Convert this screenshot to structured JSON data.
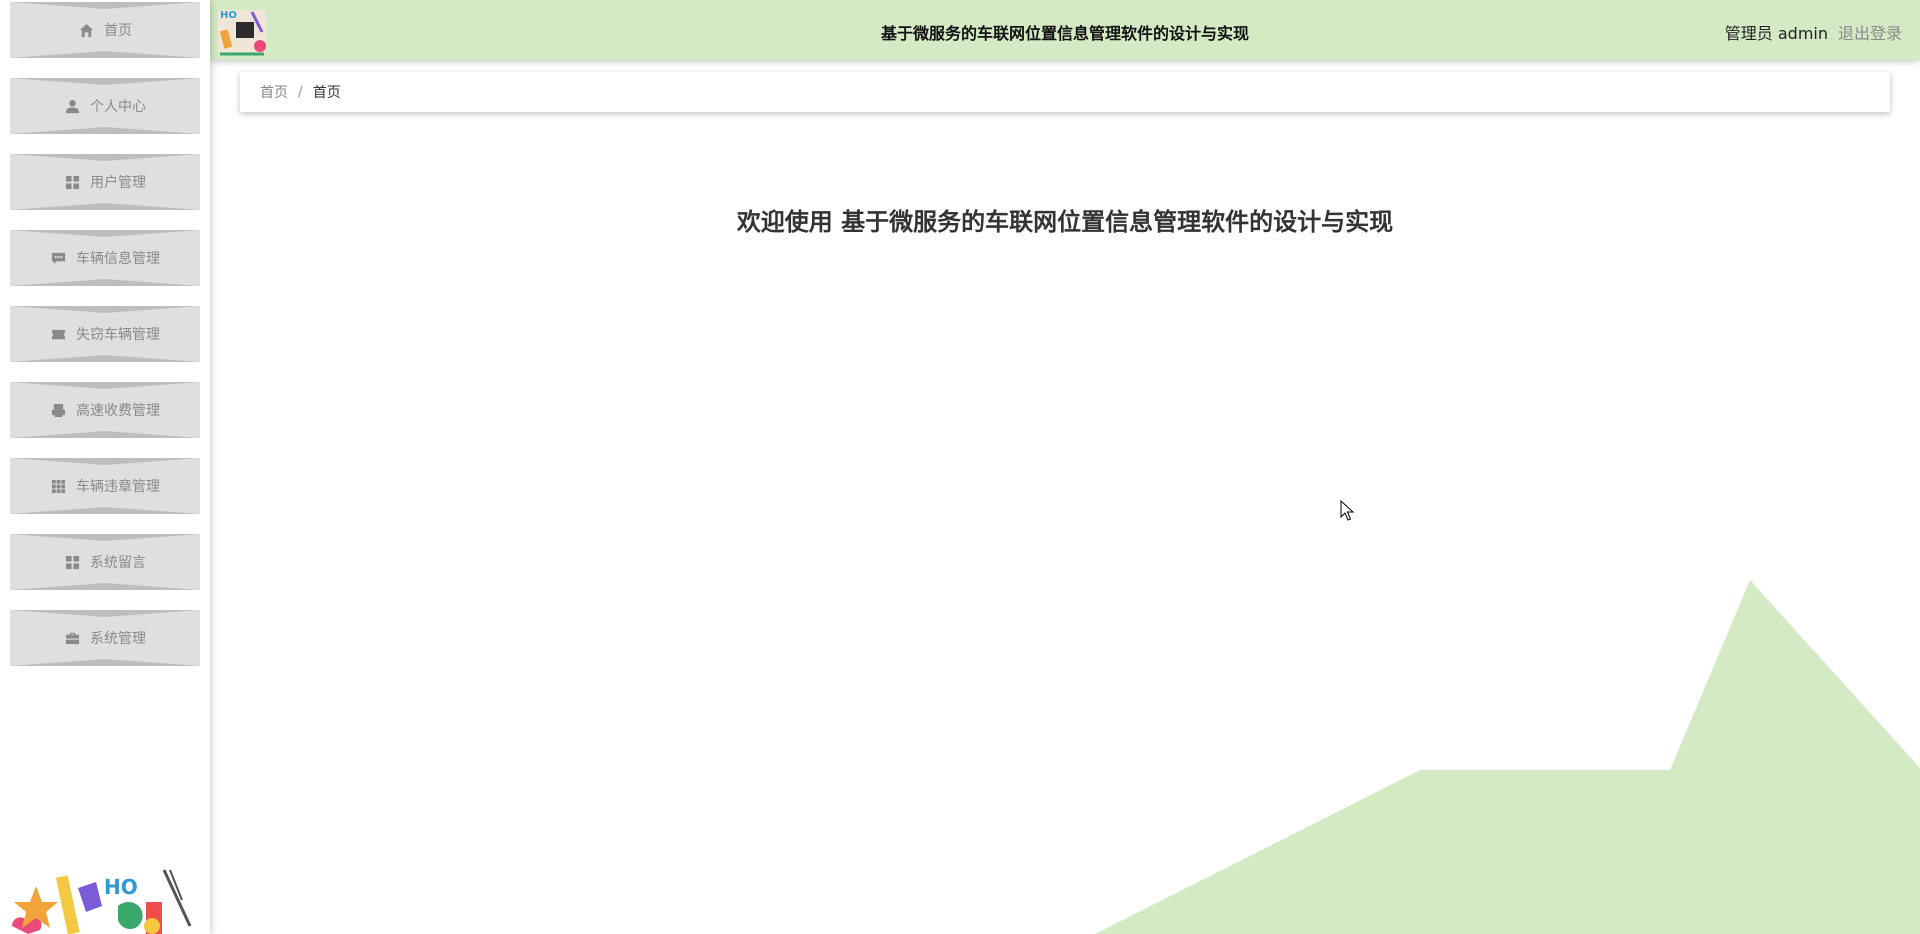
{
  "sidebar": {
    "items": [
      {
        "label": "首页",
        "icon": "home-icon"
      },
      {
        "label": "个人中心",
        "icon": "user-icon"
      },
      {
        "label": "用户管理",
        "icon": "grid-icon"
      },
      {
        "label": "车辆信息管理",
        "icon": "comment-icon"
      },
      {
        "label": "失窃车辆管理",
        "icon": "ticket-icon"
      },
      {
        "label": "高速收费管理",
        "icon": "printer-icon"
      },
      {
        "label": "车辆违章管理",
        "icon": "apps-icon"
      },
      {
        "label": "系统留言",
        "icon": "grid-icon"
      },
      {
        "label": "系统管理",
        "icon": "briefcase-icon"
      }
    ]
  },
  "header": {
    "title": "基于微服务的车联网位置信息管理软件的设计与实现",
    "user": "管理员 admin",
    "logout": "退出登录"
  },
  "breadcrumb": {
    "home": "首页",
    "separator": "/",
    "current": "首页"
  },
  "main": {
    "welcome": "欢迎使用 基于微服务的车联网位置信息管理软件的设计与实现"
  },
  "colors": {
    "header_bg": "#d4eac4",
    "menu_bg": "#dfdfdf",
    "shape_green": "#d4eac4"
  }
}
